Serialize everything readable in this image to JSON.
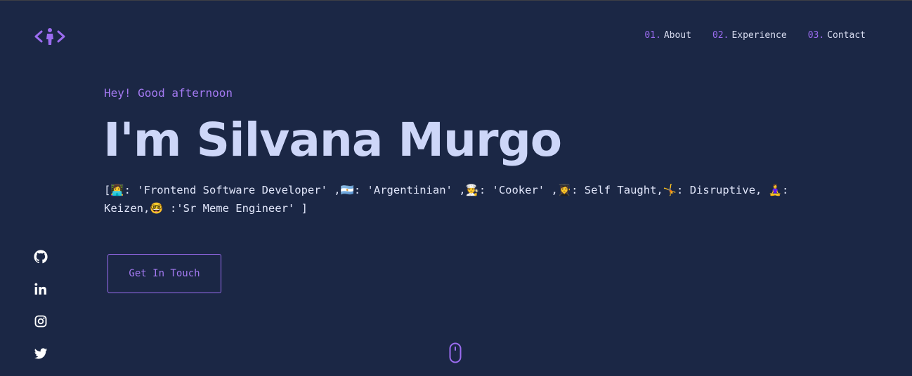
{
  "header": {
    "logo_icon": "code-person-icon",
    "nav": [
      {
        "num": "01.",
        "label": "About"
      },
      {
        "num": "02.",
        "label": "Experience"
      },
      {
        "num": "03.",
        "label": "Contact"
      }
    ]
  },
  "hero": {
    "greeting": "Hey! Good afternoon",
    "title": "I'm Silvana Murgo",
    "bio": "[👩‍💻: 'Frontend Software Developer' ,🇦🇷: 'Argentinian' ,🧑‍🍳: 'Cooker' ,👩‍🎓: Self Taught,🤸: Disruptive, 🧘‍♀️: Keizen,🤓 :'Sr Meme Engineer' ]",
    "cta_label": "Get In Touch"
  },
  "socials": [
    {
      "icon": "github-icon"
    },
    {
      "icon": "linkedin-icon"
    },
    {
      "icon": "instagram-icon"
    },
    {
      "icon": "twitter-icon"
    }
  ],
  "scroll_icon": "mouse-scroll-icon",
  "colors": {
    "background": "#1b2745",
    "accent": "#9b6cf0",
    "title": "#cdd6f8",
    "text": "#e2e7fb"
  }
}
